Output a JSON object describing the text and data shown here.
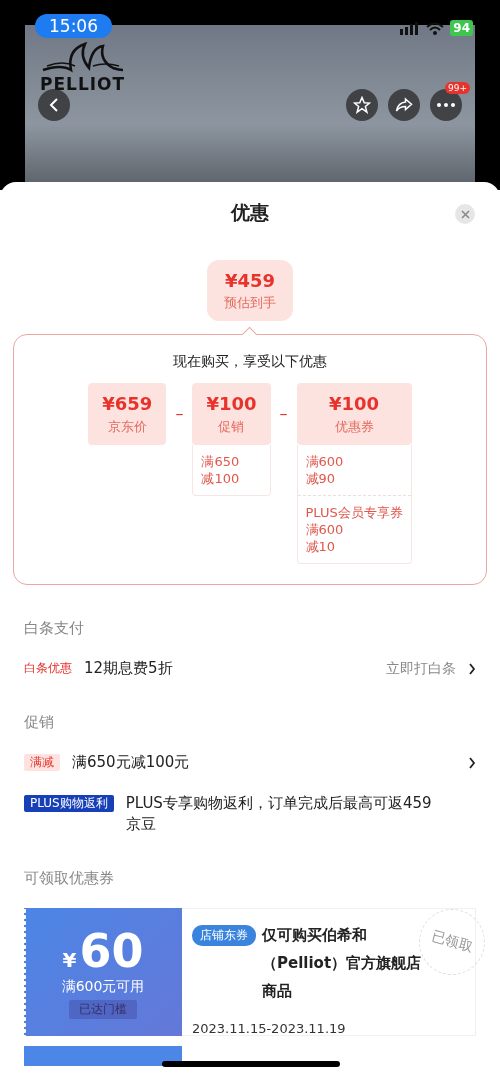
{
  "status_bar": {
    "time": "15:06",
    "battery": "94"
  },
  "header": {
    "logo_text": "PELLIOT",
    "badge": "99+"
  },
  "sheet": {
    "title": "优惠"
  },
  "estimate": {
    "price": "¥459",
    "label": "预估到手"
  },
  "breakdown": {
    "heading": "现在购买，享受以下优惠",
    "terms": [
      {
        "kind": "term",
        "amount": "¥659",
        "label": "京东价"
      },
      {
        "kind": "operator",
        "symbol": "–"
      },
      {
        "kind": "term",
        "amount": "¥100",
        "label": "促销",
        "details": [
          {
            "lines": [
              "满650",
              "减100"
            ]
          }
        ]
      },
      {
        "kind": "operator",
        "symbol": "–"
      },
      {
        "kind": "term",
        "amount": "¥100",
        "label": "优惠券",
        "details": [
          {
            "lines": [
              "满600",
              "减90"
            ]
          },
          {
            "lines": [
              "PLUS会员专享券",
              "满600",
              "减10"
            ]
          }
        ]
      }
    ]
  },
  "baitiao": {
    "title": "白条支付",
    "tag": "白条优惠",
    "text": "12期息费5折",
    "action": "立即打白条"
  },
  "promotions": {
    "title": "促销",
    "rows": [
      {
        "kind": "light",
        "tag": "满减",
        "text": "满650元减100元",
        "has_arrow": true
      },
      {
        "kind": "plus",
        "tag": "PLUS购物返利",
        "text": "PLUS专享购物返利，订单完成后最高可返459京豆",
        "has_arrow": false
      }
    ]
  },
  "coupons": {
    "title": "可领取优惠券",
    "items": [
      {
        "symbol": "¥",
        "amount": "60",
        "condition": "满600元可用",
        "status": "已达门槛",
        "tag": "店铺东券",
        "description": "仅可购买伯希和（Pelliot）官方旗舰店商品",
        "dates": "2023.11.15-2023.11.19",
        "stamp": "已领取"
      }
    ]
  }
}
